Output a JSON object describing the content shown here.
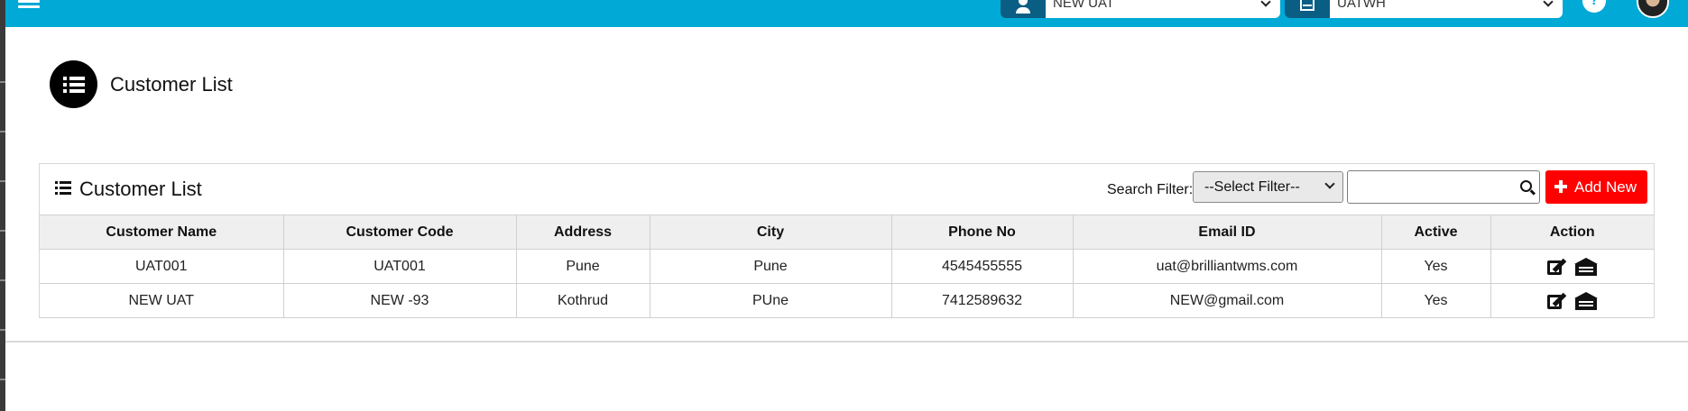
{
  "topbar": {
    "client_select": {
      "value": "NEW UAT"
    },
    "warehouse_select": {
      "value": "UATWH"
    }
  },
  "page": {
    "title": "Customer List"
  },
  "card": {
    "title": "Customer List",
    "search_filter_label": "Search Filter:",
    "filter_select_value": "--Select Filter--",
    "search_value": "",
    "add_button_label": "Add New"
  },
  "table": {
    "columns": [
      "Customer Name",
      "Customer Code",
      "Address",
      "City",
      "Phone No",
      "Email ID",
      "Active",
      "Action"
    ],
    "rows": [
      {
        "name": "UAT001",
        "code": "UAT001",
        "address": "Pune",
        "city": "Pune",
        "phone": "4545455555",
        "email": "uat@brilliantwms.com",
        "active": "Yes",
        "actions": [
          "edit-icon",
          "warehouse-icon"
        ]
      },
      {
        "name": "NEW UAT",
        "code": "NEW -93",
        "address": "Kothrud",
        "city": "PUne",
        "phone": "7412589632",
        "email": "NEW@gmail.com",
        "active": "Yes",
        "actions": [
          "edit-icon",
          "warehouse-icon"
        ]
      }
    ]
  },
  "colors": {
    "topbar": "#00a9d6",
    "topbar_icon_bg": "#0a5e84",
    "add_button": "#ff0000",
    "header_row": "#efefef"
  }
}
